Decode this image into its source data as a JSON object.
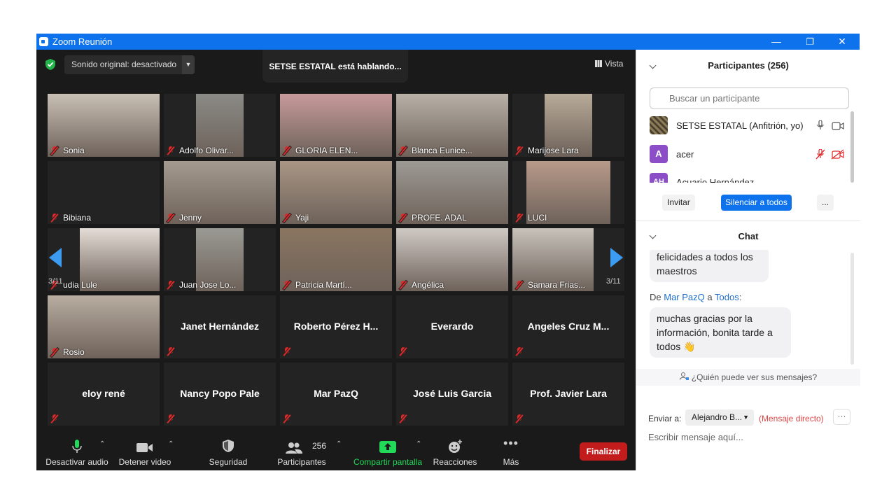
{
  "window": {
    "title": "Zoom Reunión",
    "controls": {
      "minimize": "—",
      "restore": "❐",
      "close": "✕"
    }
  },
  "meeting": {
    "sound_original": "Sonido original: desactivado",
    "speaking": "SETSE ESTATAL está hablando...",
    "view_label": "Vista",
    "page_indicator": "3/11"
  },
  "tiles": [
    [
      "Sonia",
      "Adolfo Olivar...",
      "GLORIA ELEN...",
      "Blanca Eunice...",
      "Marijose Lara"
    ],
    [
      "Bibiana",
      "Jenny",
      "Yaji",
      "PROFE. ADAL",
      "LUCI"
    ],
    [
      "udia Lule",
      "Juan Jose Lo...",
      "Patricia Martí...",
      "Angélica",
      "Samara Frias..."
    ],
    [
      "Rosio",
      "Janet Hernández",
      "Roberto Pérez H...",
      "Everardo",
      "Angeles Cruz M..."
    ],
    [
      "eloy rené",
      "Nancy Popo Pale",
      "Mar PazQ",
      "José Luis Garcia",
      "Prof. Javier Lara"
    ]
  ],
  "colors": {
    "accent_blue": "#0e72ed",
    "end_red": "#c21c1c",
    "mic_red": "#e02828",
    "share_green": "#23d959"
  },
  "toolbar": {
    "mute": "Desactivar audio",
    "video": "Detener video",
    "security": "Seguridad",
    "participants": "Participantes",
    "participants_count": "256",
    "share": "Compartir pantalla",
    "reactions": "Reacciones",
    "more": "Más",
    "end": "Finalizar"
  },
  "participants_panel": {
    "title": "Participantes (256)",
    "search_placeholder": "Buscar un participante",
    "rows": [
      {
        "avatar": "",
        "name": "SETSE ESTATAL (Anfitrión, yo)",
        "avatar_color": "#6b5d3e"
      },
      {
        "avatar": "A",
        "name": "acer",
        "avatar_color": "#8b4ec7"
      },
      {
        "avatar": "AH",
        "name": "Acuario Hernández",
        "avatar_color": "#8b4ec7"
      }
    ],
    "invite": "Invitar",
    "mute_all": "Silenciar a todos",
    "more": "..."
  },
  "chat": {
    "title": "Chat",
    "msg1": "felicidades a todos los maestros",
    "from_prefix": "De",
    "from_name": "Mar PazQ",
    "from_mid": "a",
    "from_to": "Todos",
    "from_suffix": ":",
    "msg2": "muchas gracias por la información, bonita tarde a todos 👋",
    "who_sees": "¿Quién puede ver sus mensajes?",
    "send_to_label": "Enviar a:",
    "send_to_value": "Alejandro B...",
    "direct": "(Mensaje directo)",
    "more": "···",
    "input_placeholder": "Escribir mensaje aquí..."
  }
}
